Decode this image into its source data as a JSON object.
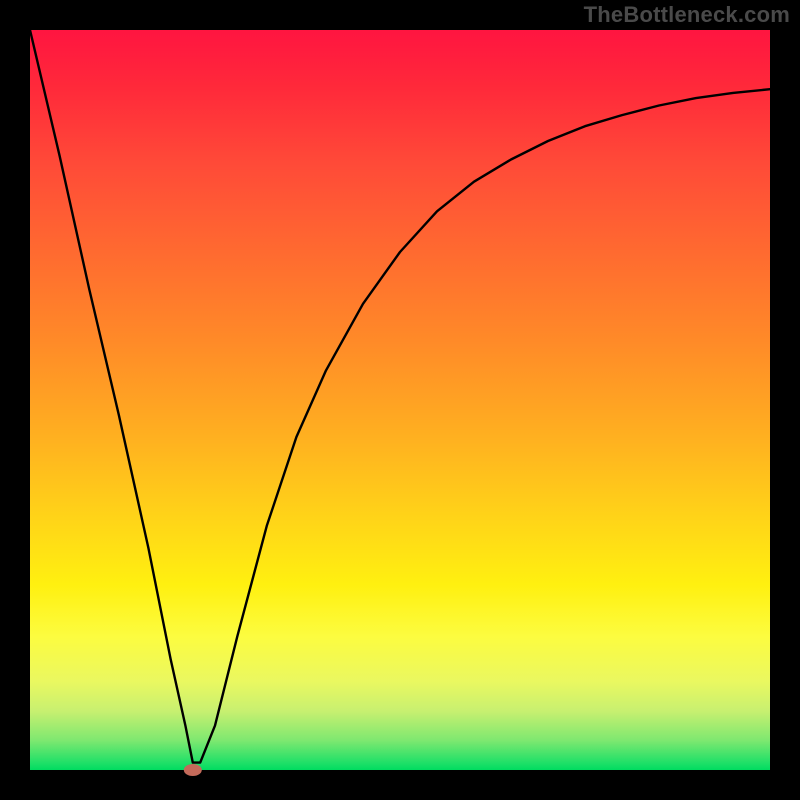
{
  "watermark": "TheBottleneck.com",
  "chart_data": {
    "type": "line",
    "title": "",
    "xlabel": "",
    "ylabel": "",
    "ylim": [
      0,
      100
    ],
    "xlim": [
      0,
      100
    ],
    "series": [
      {
        "name": "curve",
        "x": [
          0,
          4,
          8,
          12,
          16,
          19,
          21,
          22,
          23,
          25,
          28,
          32,
          36,
          40,
          45,
          50,
          55,
          60,
          65,
          70,
          75,
          80,
          85,
          90,
          95,
          100
        ],
        "y": [
          100,
          83,
          65,
          48,
          30,
          15,
          6,
          1,
          1,
          6,
          18,
          33,
          45,
          54,
          63,
          70,
          75.5,
          79.5,
          82.5,
          85,
          87,
          88.5,
          89.8,
          90.8,
          91.5,
          92
        ]
      }
    ],
    "marker": {
      "x": 22,
      "y": 0,
      "color": "#c46a5a",
      "rx": 9,
      "ry": 6
    },
    "gradient_stops": [
      {
        "pos": 0,
        "color": "#ff1540"
      },
      {
        "pos": 50,
        "color": "#ff8a28"
      },
      {
        "pos": 75,
        "color": "#fff010"
      },
      {
        "pos": 100,
        "color": "#00dc60"
      }
    ]
  }
}
